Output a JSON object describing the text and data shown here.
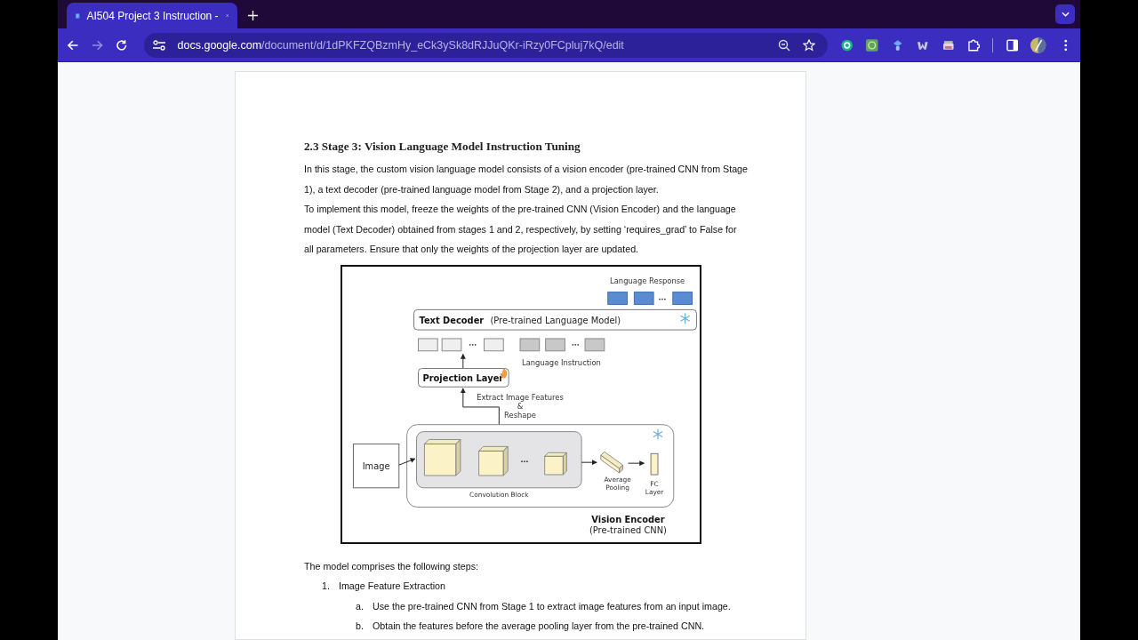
{
  "browser": {
    "tab": {
      "title": "AI504 Project 3 Instruction -",
      "selected": true
    },
    "url": {
      "host": "docs.google.com",
      "path": "/document/d/1dPKFZQBzmHy_eCk3ySk8dRJJuQKr-iRzy0FCpluj7kQ/edit"
    },
    "forward_disabled": true
  },
  "document": {
    "heading": "2.3 Stage 3: Vision Language Model Instruction Tuning",
    "paragraphs": [
      "In this stage, the custom vision language model consists of a vision encoder (pre-trained CNN from Stage 1), a text decoder (pre-trained language model from Stage 2), and a projection layer.",
      "To implement this model, freeze the weights of the pre-trained CNN (Vision Encoder) and the language model (Text Decoder) obtained from stages 1 and 2, respectively, by setting ‘requires_grad’ to False for all parameters. Ensure that only the weights of the projection layer are updated."
    ],
    "figure": {
      "language_response": "Language Response",
      "text_decoder": {
        "title": "Text Decoder",
        "subtitle": "(Pre-trained Language Model)",
        "frozen": true
      },
      "language_instruction": "Language Instruction",
      "projection_layer": {
        "title": "Projection Layer",
        "trainable": true
      },
      "extract_caption": [
        "Extract Image Features",
        "&",
        "Reshape"
      ],
      "image": "Image",
      "convolution_block": "Convolution Block",
      "average_pooling": [
        "Average",
        "Pooling"
      ],
      "fc_layer": [
        "FC",
        "Layer"
      ],
      "vision_encoder": {
        "title": "Vision Encoder",
        "subtitle": "(Pre-trained CNN)",
        "frozen": true
      }
    },
    "intro": "The model comprises the following steps:",
    "steps": [
      {
        "number": "1.",
        "title": "Image Feature Extraction",
        "children": [
          {
            "number": "a.",
            "text": "Use the pre-trained CNN from Stage 1 to extract image features from an input image."
          },
          {
            "number": "b.",
            "text": "Obtain the features before the average pooling layer from the pre-trained CNN."
          }
        ]
      }
    ]
  }
}
